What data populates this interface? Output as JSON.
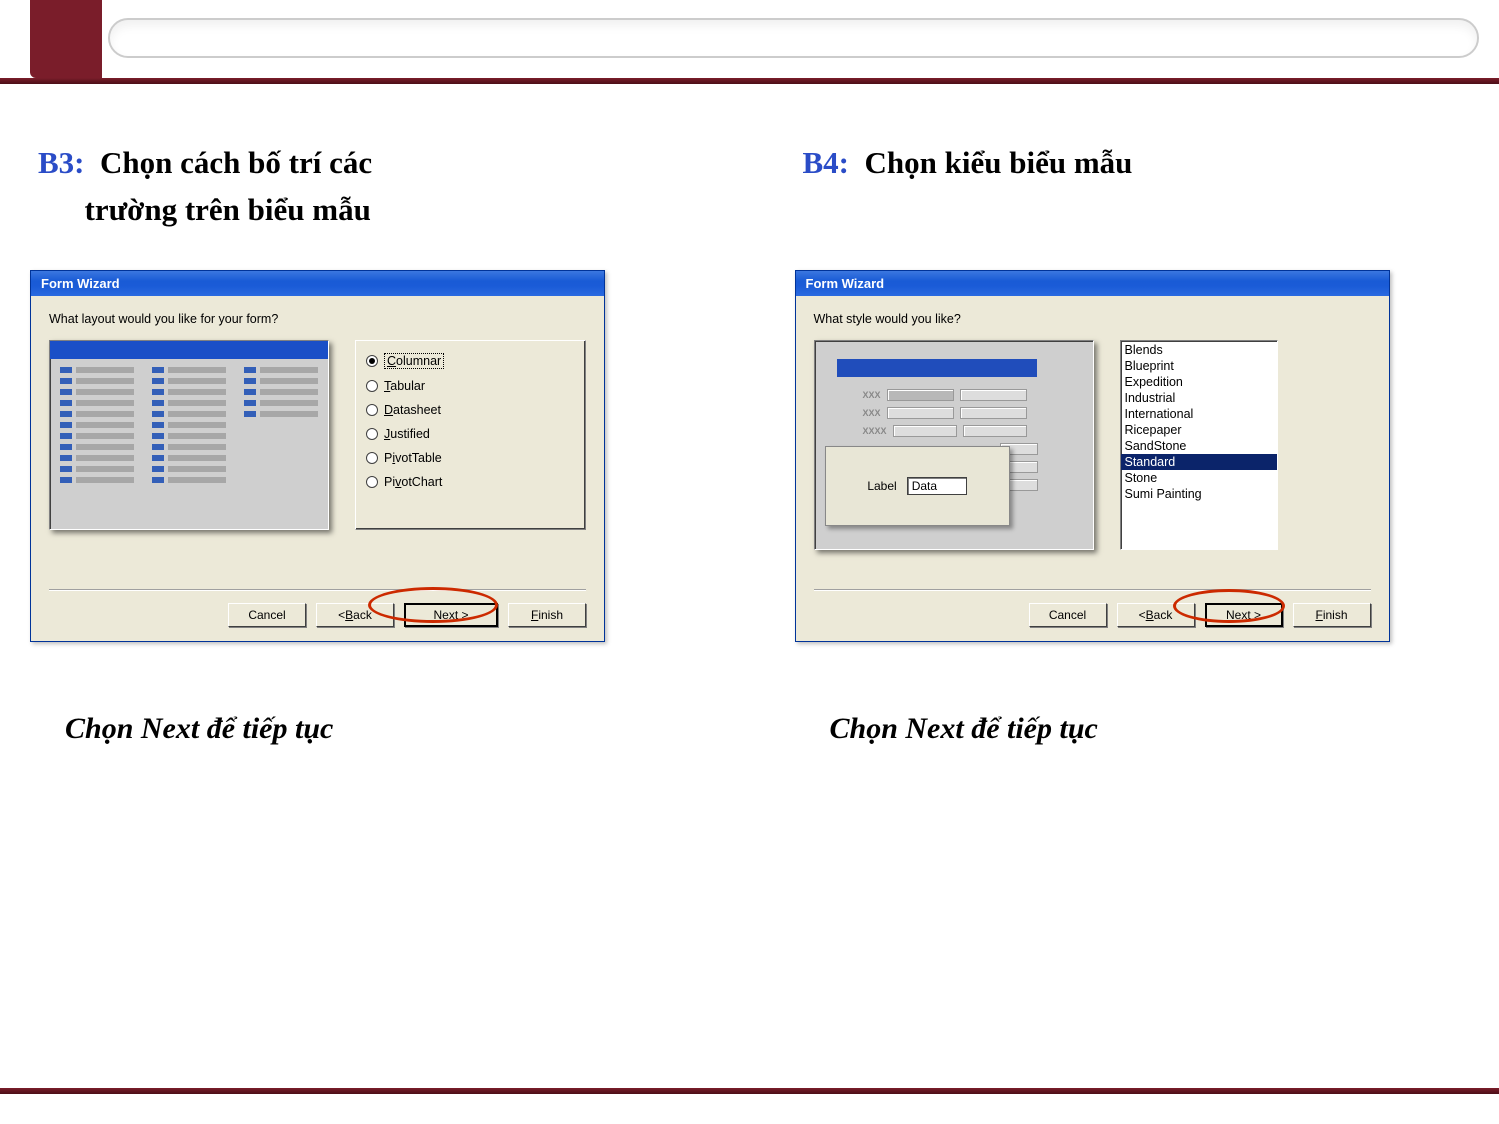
{
  "headings": {
    "b3_label": "B3:",
    "b3_text1": "Chọn cách bố trí các",
    "b3_text2": "trường trên biểu mẫu",
    "b4_label": "B4:",
    "b4_text": "Chọn kiểu biểu mẫu"
  },
  "dialog_left": {
    "title": "Form Wizard",
    "prompt": "What layout would you like for your form?",
    "options": {
      "columnar": "Columnar",
      "tabular": "Tabular",
      "datasheet": "Datasheet",
      "justified": "Justified",
      "pivot_table": "PivotTable",
      "pivot_chart": "PivotChart",
      "ul_columnar": "C",
      "ul_tabular": "T",
      "ul_datasheet": "D",
      "ul_justified": "J",
      "ul_pivot_table": "i",
      "ul_pivot_chart": "v"
    }
  },
  "dialog_right": {
    "title": "Form Wizard",
    "prompt": "What style would you like?",
    "styles": {
      "s0": "Blends",
      "s1": "Blueprint",
      "s2": "Expedition",
      "s3": "Industrial",
      "s4": "International",
      "s5": "Ricepaper",
      "s6": "SandStone",
      "s7": "Standard",
      "s8": "Stone",
      "s9": "Sumi Painting"
    },
    "preview": {
      "xxx1": "XXX",
      "xxx2": "XXX",
      "xxxx": "XXXX",
      "label": "Label",
      "data": "Data"
    }
  },
  "buttons": {
    "cancel": "Cancel",
    "back_ul": "B",
    "back_rest": "ack",
    "back_lt": "< ",
    "next_ul": "N",
    "next_rest": "ext >",
    "finish_ul": "F",
    "finish_rest": "inish"
  },
  "captions": {
    "left": "Chọn Next để tiếp tục",
    "right": "Chọn Next để tiếp tục"
  }
}
